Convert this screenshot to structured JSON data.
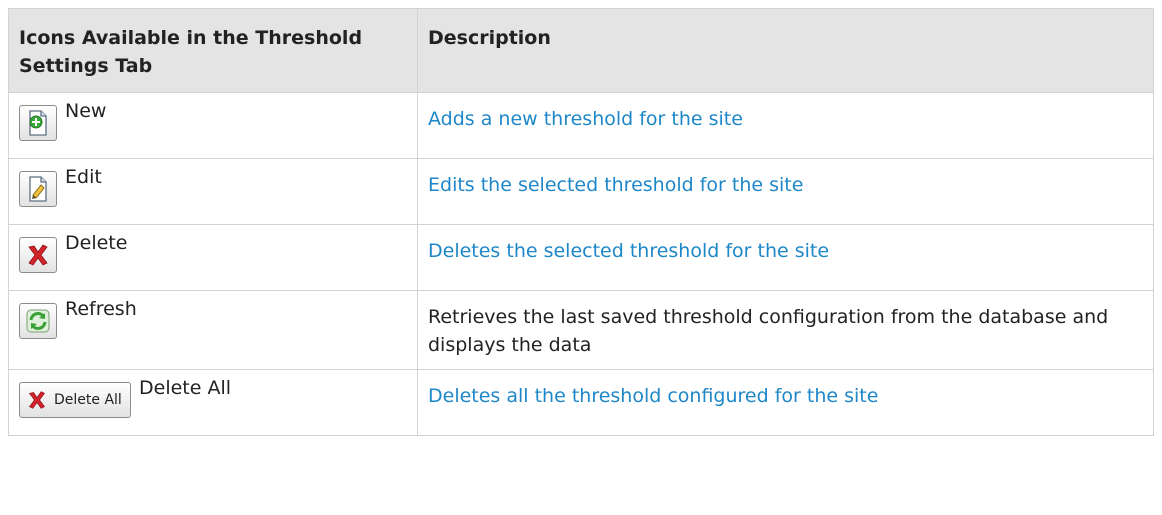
{
  "table": {
    "headers": [
      "Icons Available in the Threshold Settings Tab",
      "Description"
    ],
    "rows": [
      {
        "icon": "new-document-icon",
        "label": "New",
        "description": "Adds a new threshold for the site",
        "link": true
      },
      {
        "icon": "edit-document-icon",
        "label": "Edit",
        "description": "Edits the selected threshold for the site",
        "link": true
      },
      {
        "icon": "delete-x-icon",
        "label": "Delete",
        "description": "Deletes the selected threshold for the site",
        "link": true
      },
      {
        "icon": "refresh-icon",
        "label": "Refresh",
        "description": "Retrieves the last saved threshold configuration from the database and displays the data",
        "link": false
      },
      {
        "icon": "delete-all-icon",
        "label": "Delete All",
        "button_text": "Delete All",
        "description": "Deletes all the threshold configured for the site",
        "link": true
      }
    ]
  },
  "colors": {
    "link": "#1e87c8",
    "header_bg": "#e4e4e4",
    "border": "#d3d3d3",
    "delete_red": "#d2232a",
    "refresh_green": "#3aa235"
  }
}
